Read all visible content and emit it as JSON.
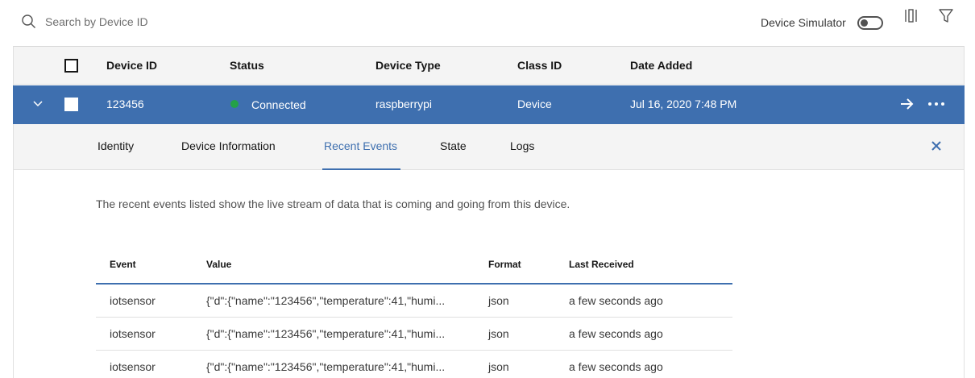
{
  "toolbar": {
    "search_placeholder": "Search by Device ID",
    "simulator_label": "Device Simulator",
    "simulator_on": false
  },
  "table": {
    "headers": [
      "Device ID",
      "Status",
      "Device Type",
      "Class ID",
      "Date Added"
    ],
    "selected_row": {
      "device_id": "123456",
      "status": "Connected",
      "device_type": "raspberrypi",
      "class_id": "Device",
      "date_added": "Jul 16, 2020 7:48 PM"
    }
  },
  "panel": {
    "tabs": [
      "Identity",
      "Device Information",
      "Recent Events",
      "State",
      "Logs"
    ],
    "active_tab": "Recent Events",
    "description": "The recent events listed show the live stream of data that is coming and going from this device.",
    "events": {
      "headers": [
        "Event",
        "Value",
        "Format",
        "Last Received"
      ],
      "rows": [
        {
          "event": "iotsensor",
          "value": "{\"d\":{\"name\":\"123456\",\"temperature\":41,\"humi...",
          "format": "json",
          "received": "a few seconds ago"
        },
        {
          "event": "iotsensor",
          "value": "{\"d\":{\"name\":\"123456\",\"temperature\":41,\"humi...",
          "format": "json",
          "received": "a few seconds ago"
        },
        {
          "event": "iotsensor",
          "value": "{\"d\":{\"name\":\"123456\",\"temperature\":41,\"humi...",
          "format": "json",
          "received": "a few seconds ago"
        }
      ]
    }
  },
  "colors": {
    "accent": "#3e6faf",
    "connected": "#24a148",
    "header_bg": "#f4f4f4"
  }
}
